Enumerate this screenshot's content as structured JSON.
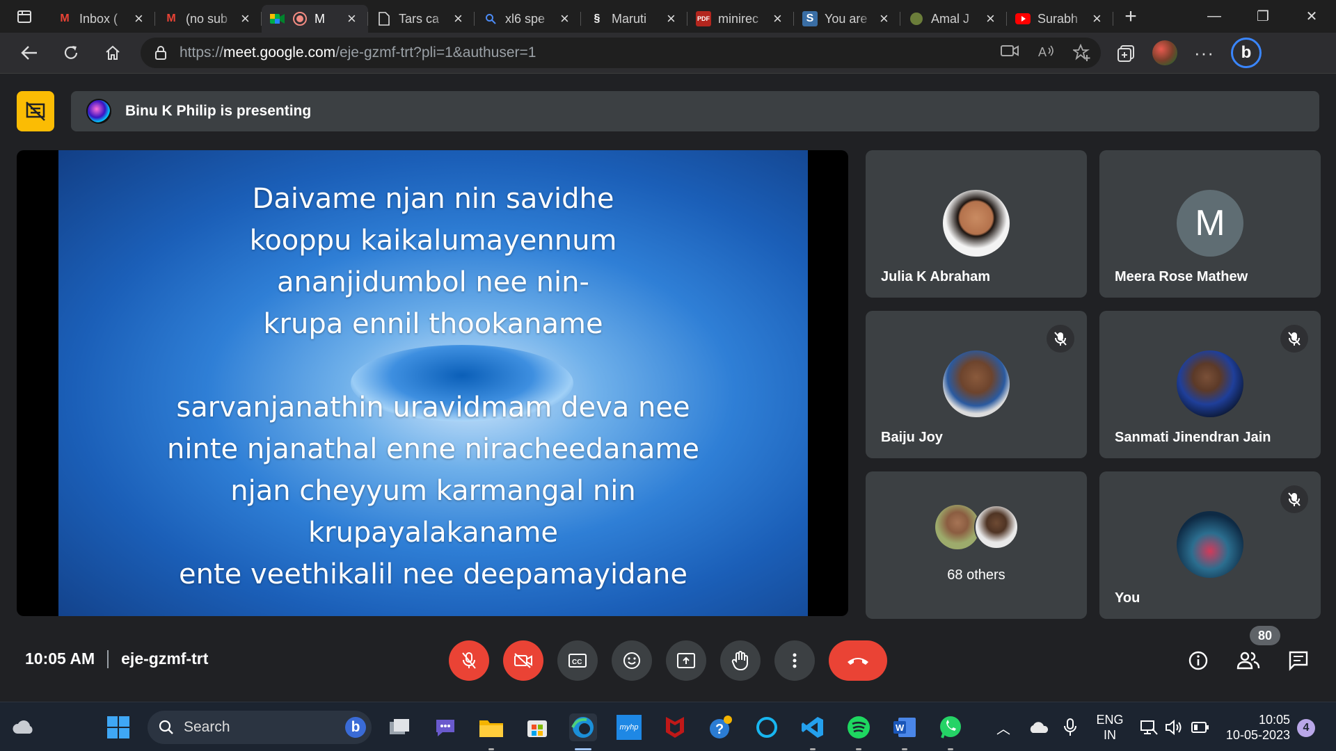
{
  "browser": {
    "tabs": [
      {
        "title": "Inbox (",
        "favicon": "gmail-icon"
      },
      {
        "title": "(no sub",
        "favicon": "gmail-icon"
      },
      {
        "title": "M",
        "favicon": "google-meet-icon",
        "active": true
      },
      {
        "title": "Tars ca",
        "favicon": "document-icon"
      },
      {
        "title": "xl6 spe",
        "favicon": "search-icon"
      },
      {
        "title": "Maruti",
        "favicon": "suzuki-icon"
      },
      {
        "title": "minirec",
        "favicon": "pdf-icon"
      },
      {
        "title": "You are",
        "favicon": "s-icon"
      },
      {
        "title": "Amal J",
        "favicon": "site-icon"
      },
      {
        "title": "Surabh",
        "favicon": "youtube-icon"
      }
    ],
    "url": {
      "scheme": "https://",
      "host": "meet.google.com",
      "path": "/eje-gzmf-trt?pli=1&authuser=1"
    }
  },
  "meet": {
    "presenting_banner": "Binu K Philip is presenting",
    "slide": {
      "lines_top": [
        "Daivame njan nin savidhe",
        "kooppu kaikalumayennum",
        "ananjidumbol nee nin-",
        "krupa ennil thookaname"
      ],
      "lines_bottom": [
        "sarvanjanathin uravidmam deva nee",
        "ninte njanathal enne niracheedaname",
        "njan cheyyum karmangal nin",
        "krupayalakaname",
        "ente veethikalil nee deepamayidane"
      ]
    },
    "participants": [
      {
        "name": "Julia K Abraham",
        "muted": false
      },
      {
        "name": "Meera Rose Mathew",
        "initial": "M",
        "muted": false
      },
      {
        "name": "Baiju Joy",
        "muted": true
      },
      {
        "name": "Sanmati Jinendran Jain",
        "muted": true
      },
      {
        "name": "68 others"
      },
      {
        "name": "You",
        "muted": true
      }
    ],
    "time": "10:05 AM",
    "meeting_code": "eje-gzmf-trt",
    "participant_count": "80",
    "colors": {
      "hangup": "#ea4335",
      "present_badge": "#fbbc04",
      "tile": "#3c4043"
    }
  },
  "taskbar": {
    "search_label": "Search",
    "language": "ENG",
    "region": "IN",
    "clock_time": "10:05",
    "clock_date": "10-05-2023",
    "notification_count": "4"
  }
}
